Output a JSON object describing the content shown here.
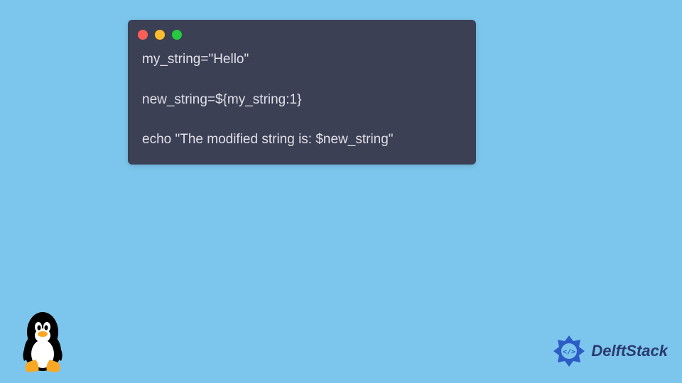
{
  "code": {
    "line1": "my_string=\"Hello\"",
    "line2": "new_string=${my_string:1}",
    "line3": "echo \"The modified string is: $new_string\""
  },
  "brand": {
    "name": "DelftStack"
  },
  "colors": {
    "bg": "#7cc6ed",
    "windowBg": "#3c4055",
    "codeText": "#e0e0e8",
    "brandText": "#2a3a6e",
    "brandAccent": "#2c5cc5"
  }
}
